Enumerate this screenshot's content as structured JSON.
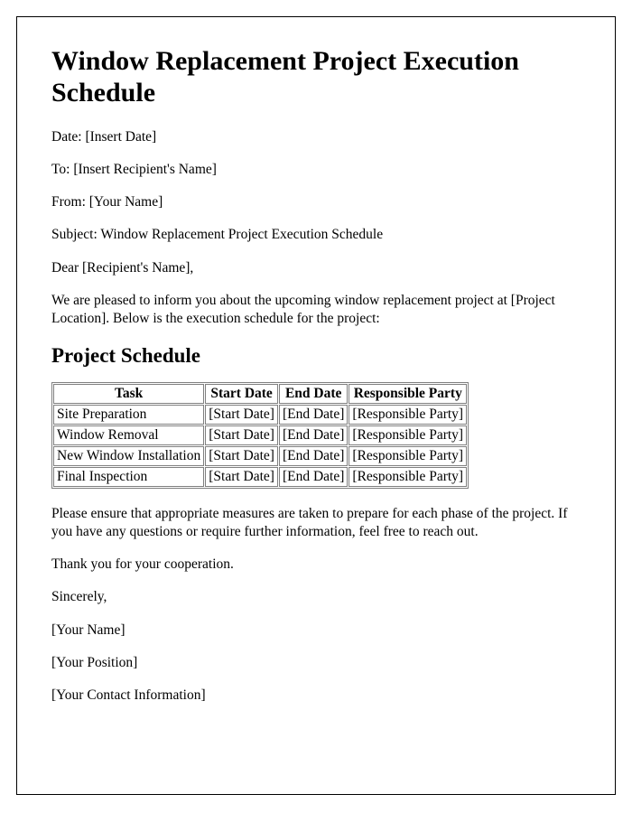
{
  "title": "Window Replacement Project Execution Schedule",
  "header": {
    "date": "Date: [Insert Date]",
    "to": "To: [Insert Recipient's Name]",
    "from": "From: [Your Name]",
    "subject": "Subject: Window Replacement Project Execution Schedule"
  },
  "salutation": "Dear [Recipient's Name],",
  "intro": "We are pleased to inform you about the upcoming window replacement project at [Project Location]. Below is the execution schedule for the project:",
  "schedule_heading": "Project Schedule",
  "table": {
    "headers": {
      "task": "Task",
      "start": "Start Date",
      "end": "End Date",
      "party": "Responsible Party"
    },
    "rows": [
      {
        "task": "Site Preparation",
        "start": "[Start Date]",
        "end": "[End Date]",
        "party": "[Responsible Party]"
      },
      {
        "task": "Window Removal",
        "start": "[Start Date]",
        "end": "[End Date]",
        "party": "[Responsible Party]"
      },
      {
        "task": "New Window Installation",
        "start": "[Start Date]",
        "end": "[End Date]",
        "party": "[Responsible Party]"
      },
      {
        "task": "Final Inspection",
        "start": "[Start Date]",
        "end": "[End Date]",
        "party": "[Responsible Party]"
      }
    ]
  },
  "closing_para": "Please ensure that appropriate measures are taken to prepare for each phase of the project. If you have any questions or require further information, feel free to reach out.",
  "thanks": "Thank you for your cooperation.",
  "signoff": "Sincerely,",
  "signature": {
    "name": "[Your Name]",
    "position": "[Your Position]",
    "contact": "[Your Contact Information]"
  }
}
